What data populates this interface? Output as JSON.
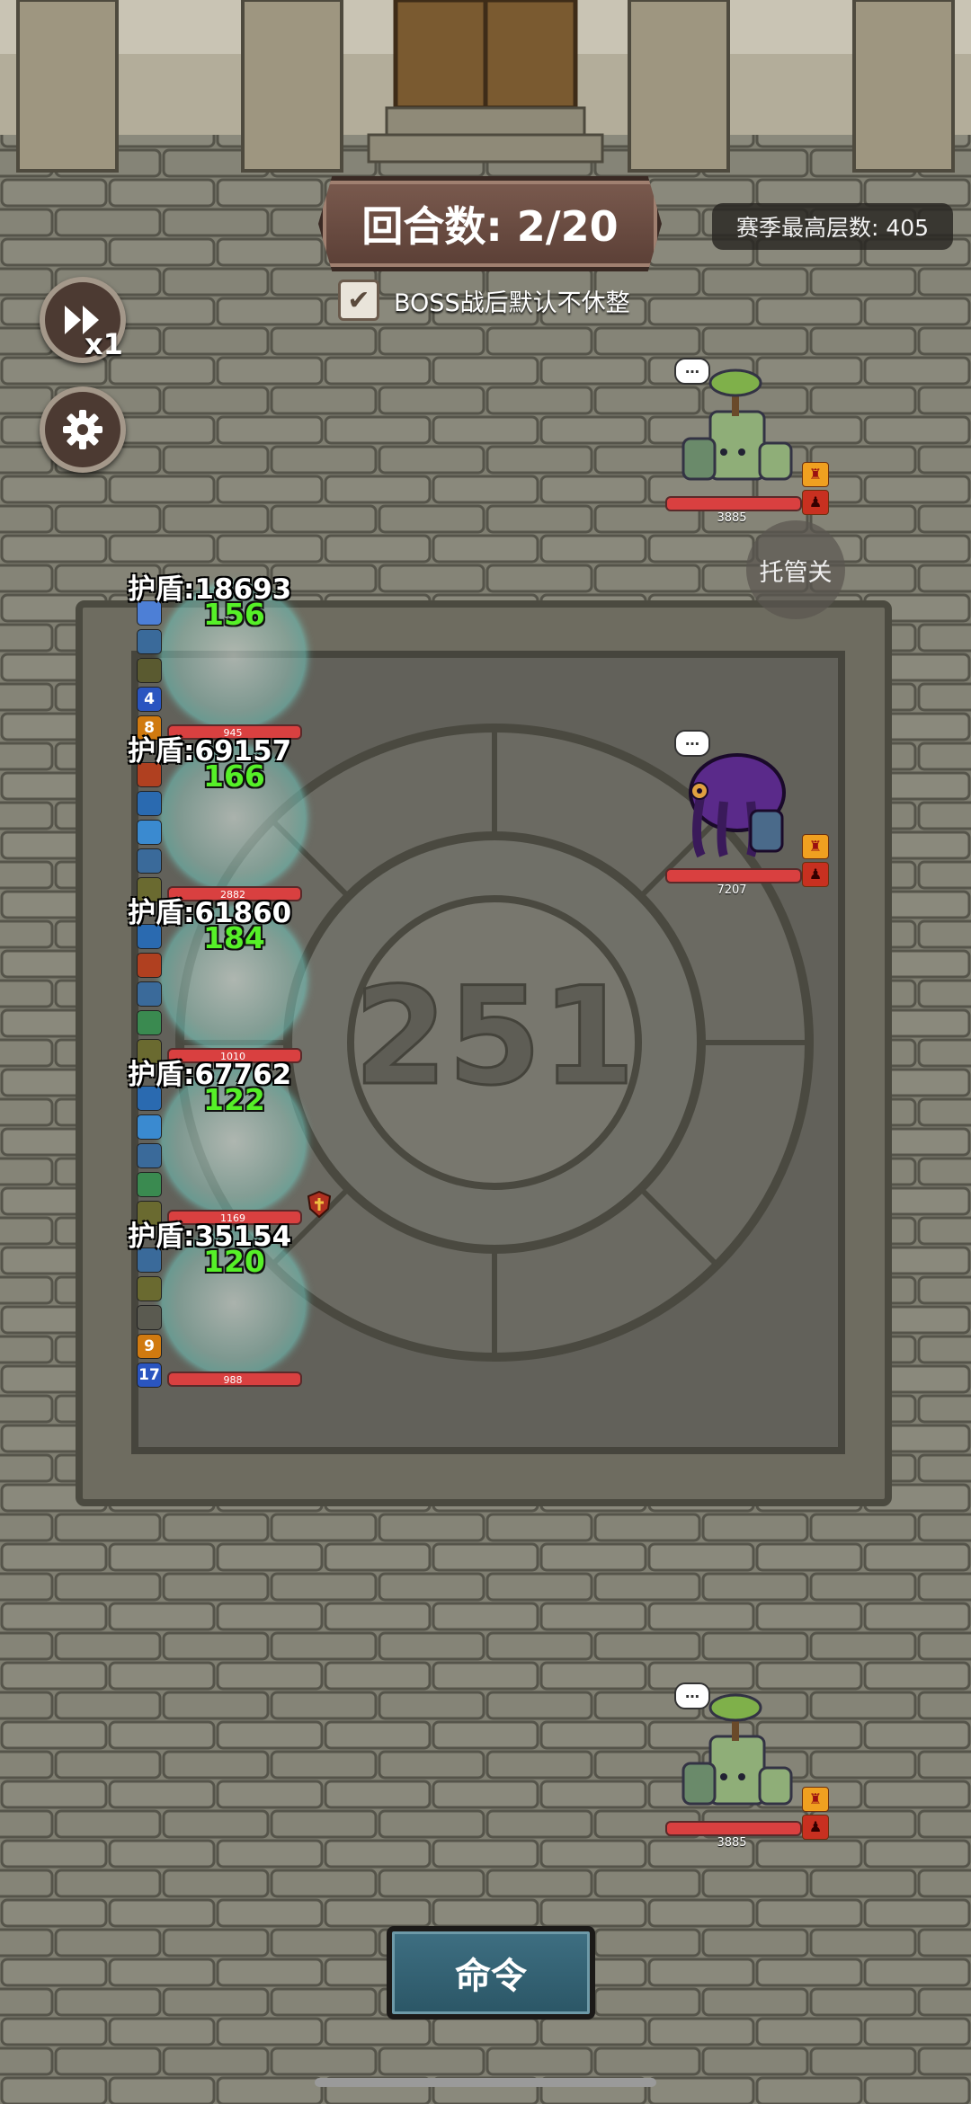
{
  "hud": {
    "round_text": "回合数: 2/20",
    "season_best": "赛季最高层数: 405",
    "boss_rest_label": "BOSS战后默认不休整",
    "boss_rest_checked": "✔",
    "speed_label": "x1",
    "auto_button": "托管关"
  },
  "arena": {
    "floor_number": "251"
  },
  "heroes": [
    {
      "shield": "护盾:18693",
      "heal": "156",
      "hp": "945",
      "icons": [
        "",
        "",
        "",
        "4",
        "8"
      ]
    },
    {
      "shield": "护盾:69157",
      "heal": "166",
      "hp": "2882",
      "icons": [
        "",
        "",
        "",
        "",
        ""
      ]
    },
    {
      "shield": "护盾:61860",
      "heal": "184",
      "hp": "1010",
      "icons": [
        "",
        "",
        "",
        "",
        ""
      ]
    },
    {
      "shield": "护盾:67762",
      "heal": "122",
      "hp": "1169",
      "icons": [
        "",
        "",
        "",
        "",
        ""
      ]
    },
    {
      "shield": "护盾:35154",
      "heal": "120",
      "hp": "988",
      "icons": [
        "",
        "",
        "",
        "9",
        "17"
      ]
    }
  ],
  "enemies": [
    {
      "name": "stone-tree-golem",
      "hp": "3885"
    },
    {
      "name": "purple-shadow-beast",
      "hp": "7207"
    },
    {
      "name": "stone-tree-golem",
      "hp": "3885"
    }
  ],
  "bottom": {
    "command_button": "命令"
  },
  "colors": {
    "shield_ring": "#5fd2c8",
    "heal_text": "#56f028",
    "hp_bar": "#d94040",
    "command_bg": "#2b5666"
  }
}
